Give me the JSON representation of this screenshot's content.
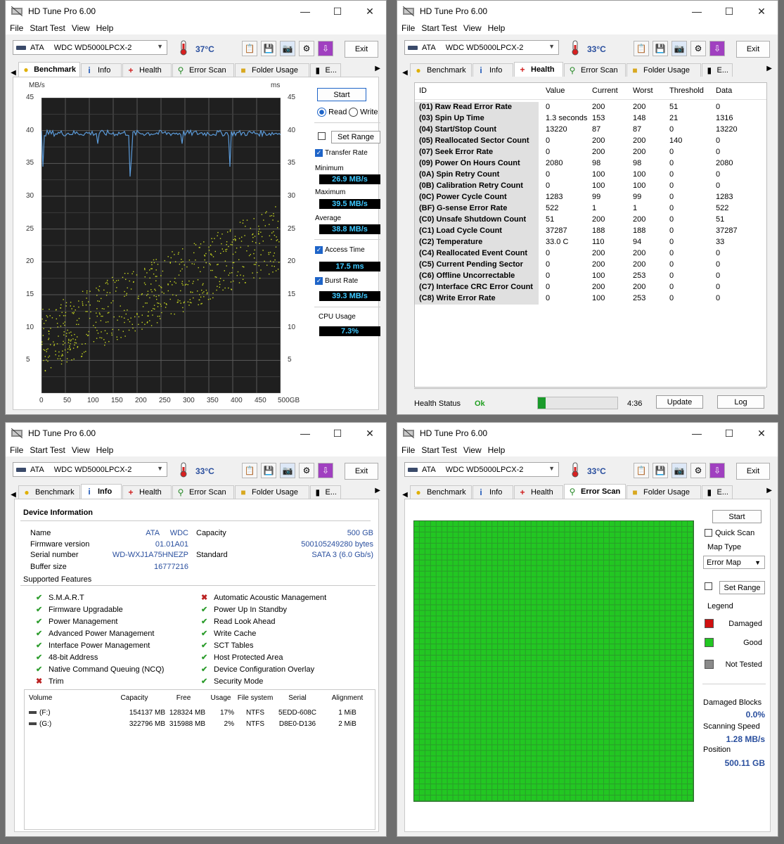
{
  "app_title": "HD Tune Pro 6.00",
  "menu": [
    "File",
    "Start Test",
    "View",
    "Help"
  ],
  "window_buttons": {
    "minimize": "—",
    "maximize": "☐",
    "close": "✕"
  },
  "drive": {
    "bus": "ATA",
    "model": "WDC WD5000LPCX-2"
  },
  "exit_label": "Exit",
  "tabs": [
    "Benchmark",
    "Info",
    "Health",
    "Error Scan",
    "Folder Usage",
    "E..."
  ],
  "windows": {
    "benchmark": {
      "temp": "37°C",
      "start": "Start",
      "read": "Read",
      "write": "Write",
      "set_range": "Set Range",
      "transfer_rate": "Transfer Rate",
      "minimum_label": "Minimum",
      "minimum": "26.9 MB/s",
      "maximum_label": "Maximum",
      "maximum": "39.5 MB/s",
      "average_label": "Average",
      "average": "38.8 MB/s",
      "access_time_label": "Access Time",
      "access_time": "17.5 ms",
      "burst_rate_label": "Burst Rate",
      "burst_rate": "39.3 MB/s",
      "cpu_usage_label": "CPU Usage",
      "cpu_usage": "7.3%",
      "y_left_unit": "MB/s",
      "y_right_unit": "ms",
      "y_ticks": [
        "45",
        "40",
        "35",
        "30",
        "25",
        "20",
        "15",
        "10",
        "5"
      ],
      "x_ticks": [
        "0",
        "50",
        "100",
        "150",
        "200",
        "250",
        "300",
        "350",
        "400",
        "450",
        "500GB"
      ]
    },
    "health": {
      "temp": "33°C",
      "columns": [
        "ID",
        "Value",
        "Current",
        "Worst",
        "Threshold",
        "Data"
      ],
      "rows": [
        [
          "(01) Raw Read Error Rate",
          "0",
          "200",
          "200",
          "51",
          "0"
        ],
        [
          "(03) Spin Up Time",
          "1.3 seconds",
          "153",
          "148",
          "21",
          "1316"
        ],
        [
          "(04) Start/Stop Count",
          "13220",
          "87",
          "87",
          "0",
          "13220"
        ],
        [
          "(05) Reallocated Sector Count",
          "0",
          "200",
          "200",
          "140",
          "0"
        ],
        [
          "(07) Seek Error Rate",
          "0",
          "200",
          "200",
          "0",
          "0"
        ],
        [
          "(09) Power On Hours Count",
          "2080",
          "98",
          "98",
          "0",
          "2080"
        ],
        [
          "(0A) Spin Retry Count",
          "0",
          "100",
          "100",
          "0",
          "0"
        ],
        [
          "(0B) Calibration Retry Count",
          "0",
          "100",
          "100",
          "0",
          "0"
        ],
        [
          "(0C) Power Cycle Count",
          "1283",
          "99",
          "99",
          "0",
          "1283"
        ],
        [
          "(BF) G-sense Error Rate",
          "522",
          "1",
          "1",
          "0",
          "522"
        ],
        [
          "(C0) Unsafe Shutdown Count",
          "51",
          "200",
          "200",
          "0",
          "51"
        ],
        [
          "(C1) Load Cycle Count",
          "37287",
          "188",
          "188",
          "0",
          "37287"
        ],
        [
          "(C2) Temperature",
          "33.0 C",
          "110",
          "94",
          "0",
          "33"
        ],
        [
          "(C4) Reallocated Event Count",
          "0",
          "200",
          "200",
          "0",
          "0"
        ],
        [
          "(C5) Current Pending Sector",
          "0",
          "200",
          "200",
          "0",
          "0"
        ],
        [
          "(C6) Offline Uncorrectable",
          "0",
          "100",
          "253",
          "0",
          "0"
        ],
        [
          "(C7) Interface CRC Error Count",
          "0",
          "200",
          "200",
          "0",
          "0"
        ],
        [
          "(C8) Write Error Rate",
          "0",
          "100",
          "253",
          "0",
          "0"
        ]
      ],
      "health_status_label": "Health Status",
      "health_status": "Ok",
      "time": "4:36",
      "update": "Update",
      "log": "Log"
    },
    "info": {
      "temp": "33°C",
      "device_information": "Device Information",
      "name_label": "Name",
      "name_value": "ATA     WDC",
      "firmware_label": "Firmware version",
      "firmware_value": "01.01A01",
      "serial_label": "Serial number",
      "serial_value": "WD-WXJ1A75HNEZP",
      "buffer_label": "Buffer size",
      "buffer_value": "16777216",
      "capacity_label": "Capacity",
      "capacity_value": "500 GB",
      "capacity_bytes": "500105249280 bytes",
      "standard_label": "Standard",
      "standard_value": "SATA 3 (6.0 Gb/s)",
      "supported_features": "Supported Features",
      "features_left": [
        {
          "name": "S.M.A.R.T",
          "ok": true
        },
        {
          "name": "Firmware Upgradable",
          "ok": true
        },
        {
          "name": "Power Management",
          "ok": true
        },
        {
          "name": "Advanced Power Management",
          "ok": true
        },
        {
          "name": "Interface Power Management",
          "ok": true
        },
        {
          "name": "48-bit Address",
          "ok": true
        },
        {
          "name": "Native Command Queuing (NCQ)",
          "ok": true
        },
        {
          "name": "Trim",
          "ok": false
        }
      ],
      "features_right": [
        {
          "name": "Automatic Acoustic Management",
          "ok": false
        },
        {
          "name": "Power Up In Standby",
          "ok": true
        },
        {
          "name": "Read Look Ahead",
          "ok": true
        },
        {
          "name": "Write Cache",
          "ok": true
        },
        {
          "name": "SCT Tables",
          "ok": true
        },
        {
          "name": "Host Protected Area",
          "ok": true
        },
        {
          "name": "Device Configuration Overlay",
          "ok": true
        },
        {
          "name": "Security Mode",
          "ok": true
        }
      ],
      "volume_columns": [
        "Volume",
        "Capacity",
        "Free",
        "Usage",
        "File system",
        "Serial",
        "Alignment"
      ],
      "volumes": [
        [
          "(F:)",
          "154137 MB",
          "128324 MB",
          "17%",
          "NTFS",
          "5EDD-608C",
          "1 MiB"
        ],
        [
          "(G:)",
          "322796 MB",
          "315988 MB",
          "2%",
          "NTFS",
          "D8E0-D136",
          "2 MiB"
        ]
      ]
    },
    "errorscan": {
      "temp": "33°C",
      "start": "Start",
      "quick_scan": "Quick Scan",
      "map_type_label": "Map Type",
      "map_type": "Error Map",
      "set_range": "Set Range",
      "legend_label": "Legend",
      "damaged": "Damaged",
      "good": "Good",
      "not_tested": "Not Tested",
      "damaged_blocks_label": "Damaged Blocks",
      "damaged_blocks": "0.0%",
      "scanning_speed_label": "Scanning Speed",
      "scanning_speed": "1.28 MB/s",
      "position_label": "Position",
      "position": "500.11 GB",
      "legend_colors": {
        "damaged": "#d01010",
        "good": "#22c722",
        "not_tested": "#8a8a8a"
      }
    }
  }
}
